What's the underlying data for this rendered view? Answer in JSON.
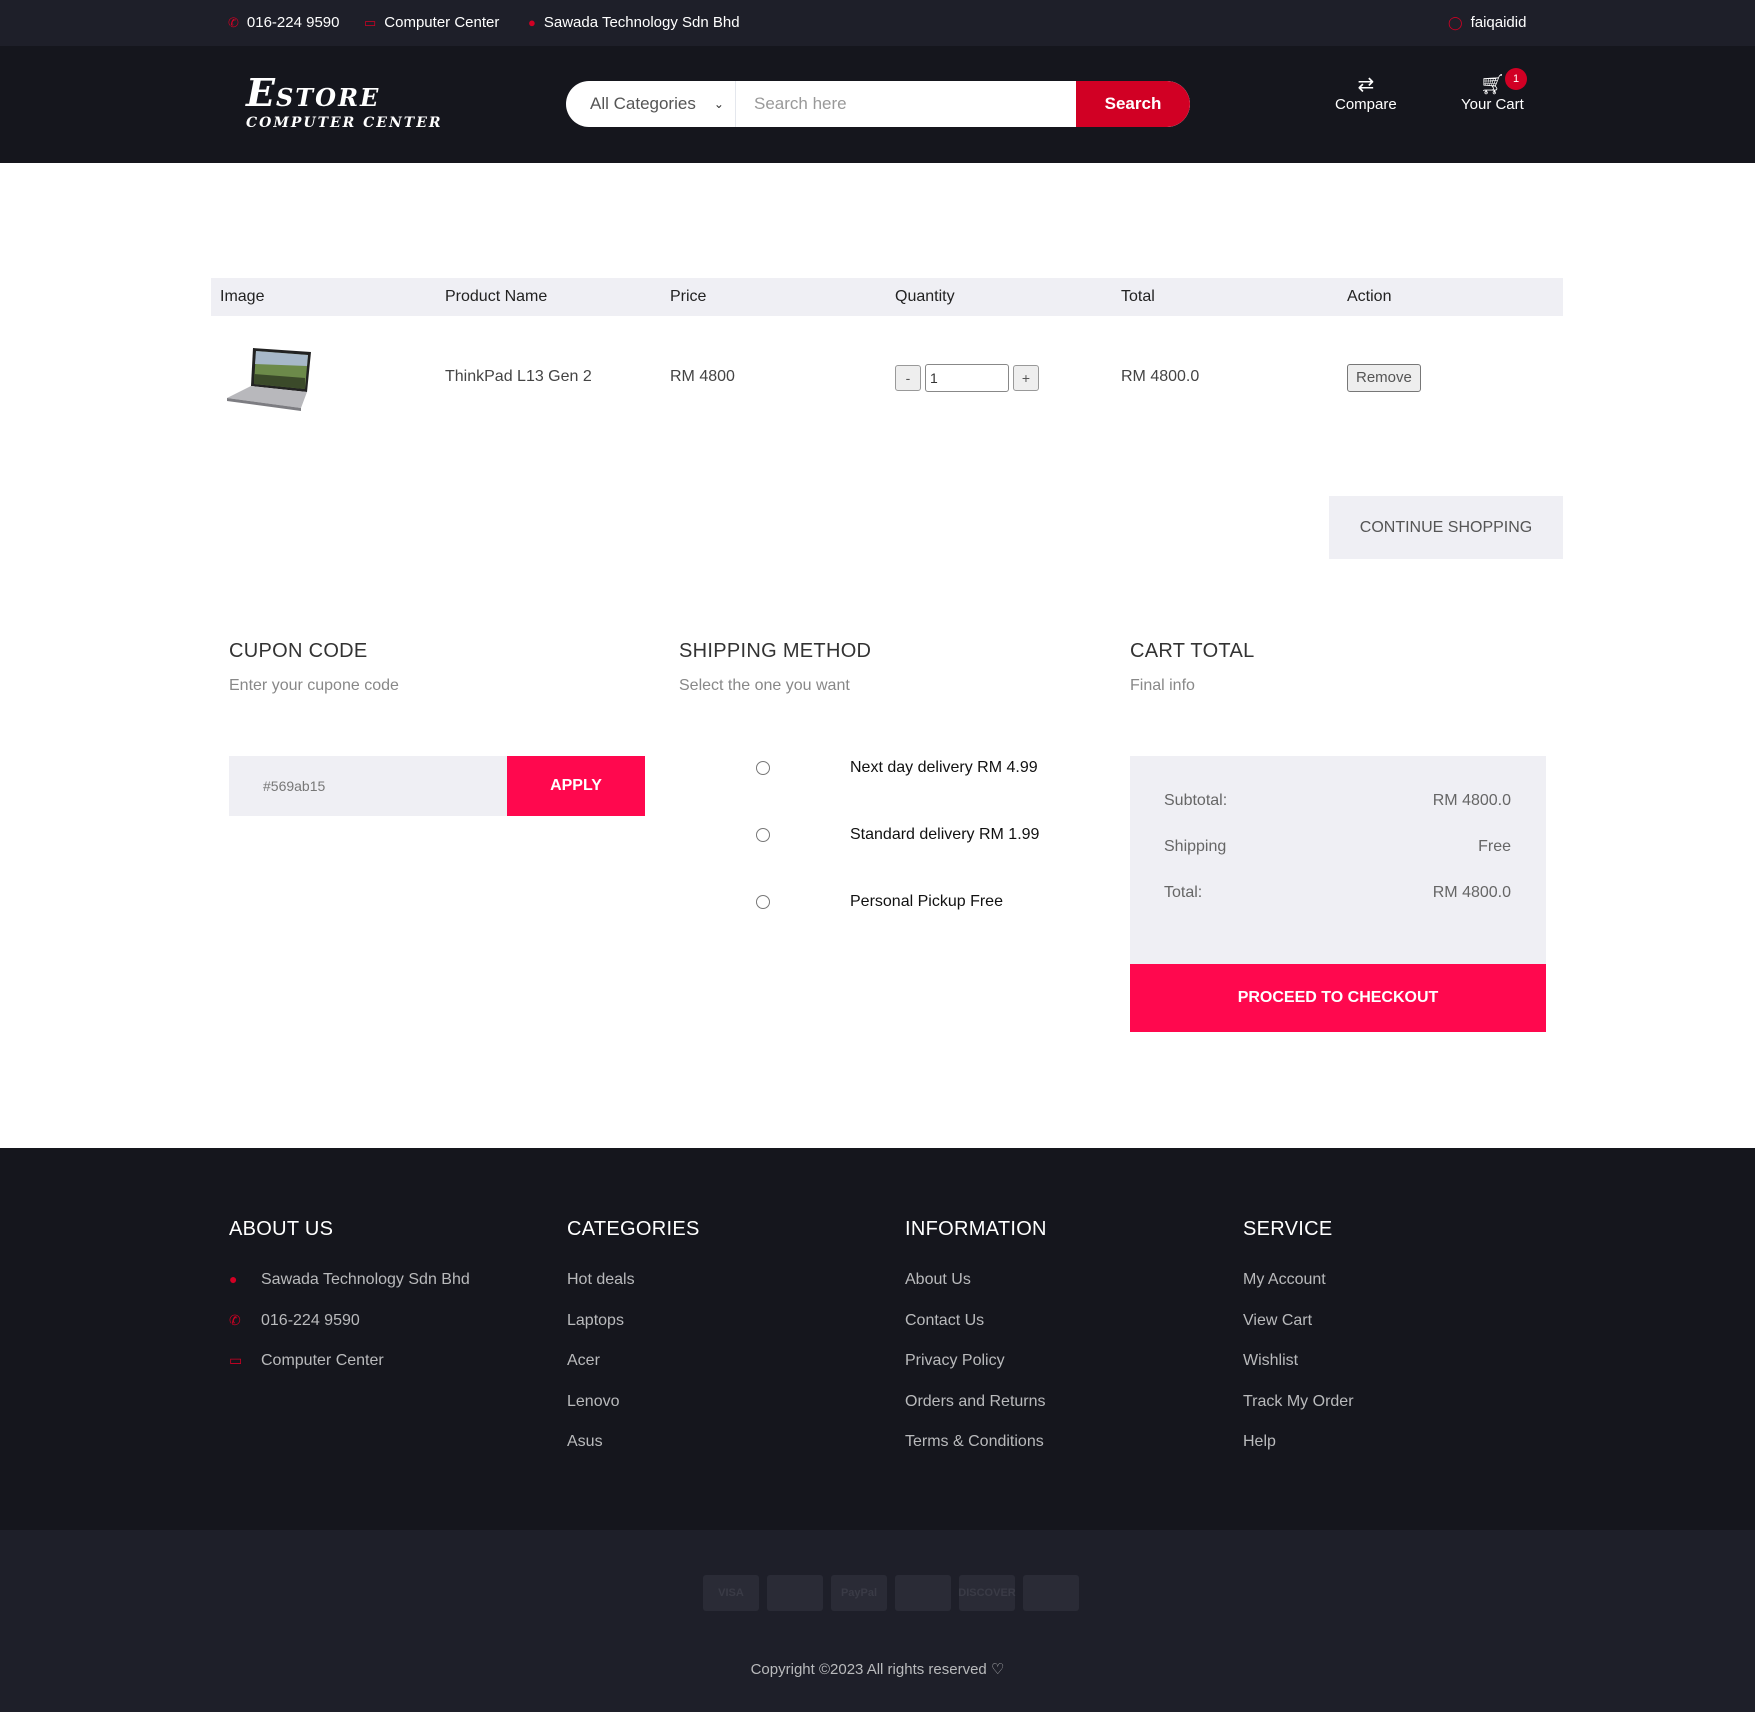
{
  "topbar": {
    "phone": "016-224 9590",
    "store": "Computer Center",
    "company": "Sawada Technology Sdn Bhd",
    "user": "faiqaidid"
  },
  "header": {
    "logo_main": "E",
    "logo_rest": "STORE",
    "logo_sub": "COMPUTER CENTER",
    "category_select": "All Categories",
    "search_placeholder": "Search here",
    "search_button": "Search",
    "compare_label": "Compare",
    "cart_label": "Your Cart",
    "cart_count": "1"
  },
  "cart": {
    "columns": [
      "Image",
      "Product Name",
      "Price",
      "Quantity",
      "Total",
      "Action"
    ],
    "items": [
      {
        "name": "ThinkPad L13 Gen 2",
        "price": "RM 4800",
        "quantity": "1",
        "total": "RM 4800.0",
        "action": "Remove",
        "minus": "-",
        "plus": "+"
      }
    ],
    "continue_label": "CONTINUE SHOPPING"
  },
  "coupon": {
    "title": "CUPON CODE",
    "subtitle": "Enter your cupone code",
    "value": "#569ab15",
    "button": "APPLY"
  },
  "shipping": {
    "title": "SHIPPING METHOD",
    "subtitle": "Select the one you want",
    "options": [
      "Next day delivery RM 4.99",
      "Standard delivery RM 1.99",
      "Personal Pickup Free"
    ]
  },
  "cart_total": {
    "title": "CART TOTAL",
    "subtitle": "Final info",
    "rows": [
      {
        "label": "Subtotal:",
        "value": "RM 4800.0"
      },
      {
        "label": "Shipping",
        "value": "Free"
      },
      {
        "label": "Total:",
        "value": "RM 4800.0"
      }
    ],
    "checkout": "PROCEED TO CHECKOUT"
  },
  "footer": {
    "about": {
      "title": "ABOUT US",
      "items": [
        "Sawada Technology Sdn Bhd",
        "016-224 9590",
        "Computer Center"
      ]
    },
    "categories": {
      "title": "CATEGORIES",
      "items": [
        "Hot deals",
        "Laptops",
        "Acer",
        "Lenovo",
        "Asus"
      ]
    },
    "information": {
      "title": "INFORMATION",
      "items": [
        "About Us",
        "Contact Us",
        "Privacy Policy",
        "Orders and Returns",
        "Terms & Conditions"
      ]
    },
    "service": {
      "title": "SERVICE",
      "items": [
        "My Account",
        "View Cart",
        "Wishlist",
        "Track My Order",
        "Help"
      ]
    },
    "payment_cards": [
      "VISA",
      "",
      "PayPal",
      "",
      "DISCOVER",
      ""
    ],
    "copyright": "Copyright ©2023 All rights reserved"
  },
  "colors": {
    "brand": "#D10024",
    "accent": "#ff084e",
    "dark": "#15161d",
    "topbar": "#1e1f29",
    "panel": "#efeff4"
  }
}
